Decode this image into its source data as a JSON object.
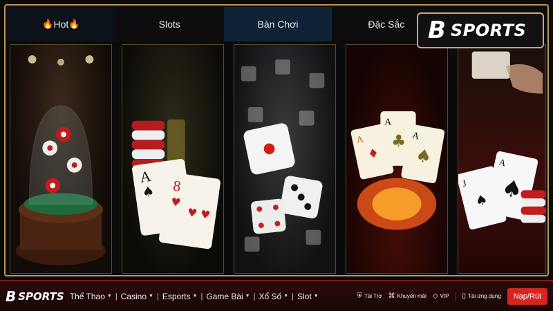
{
  "tabs": [
    {
      "label": "Hot",
      "fire": "🔥"
    },
    {
      "label": "Slots"
    },
    {
      "label": "Bàn Chơi"
    },
    {
      "label": "Đặc Sắc"
    },
    {
      "label": ""
    }
  ],
  "badge": {
    "mark": "B",
    "text": "SPORTS"
  },
  "nav": {
    "logo_mark": "B",
    "logo_text": "SPORTS",
    "items": [
      "Thể Thao",
      "Casino",
      "Esports",
      "Game Bài",
      "Xổ Số",
      "Slot"
    ],
    "utilities": [
      {
        "label": "Tài Trợ",
        "icon": "shield-icon"
      },
      {
        "label": "Khuyến mãi",
        "icon": "tag-icon"
      },
      {
        "label": "VIP",
        "icon": "diamond-icon"
      },
      {
        "label": "Tải ứng dụng",
        "icon": "phone-icon"
      }
    ],
    "cta": "Nạp/Rút"
  },
  "colors": {
    "gold": "#b89a55",
    "nav_bg": "#1b0606",
    "cta": "#d6261e"
  }
}
